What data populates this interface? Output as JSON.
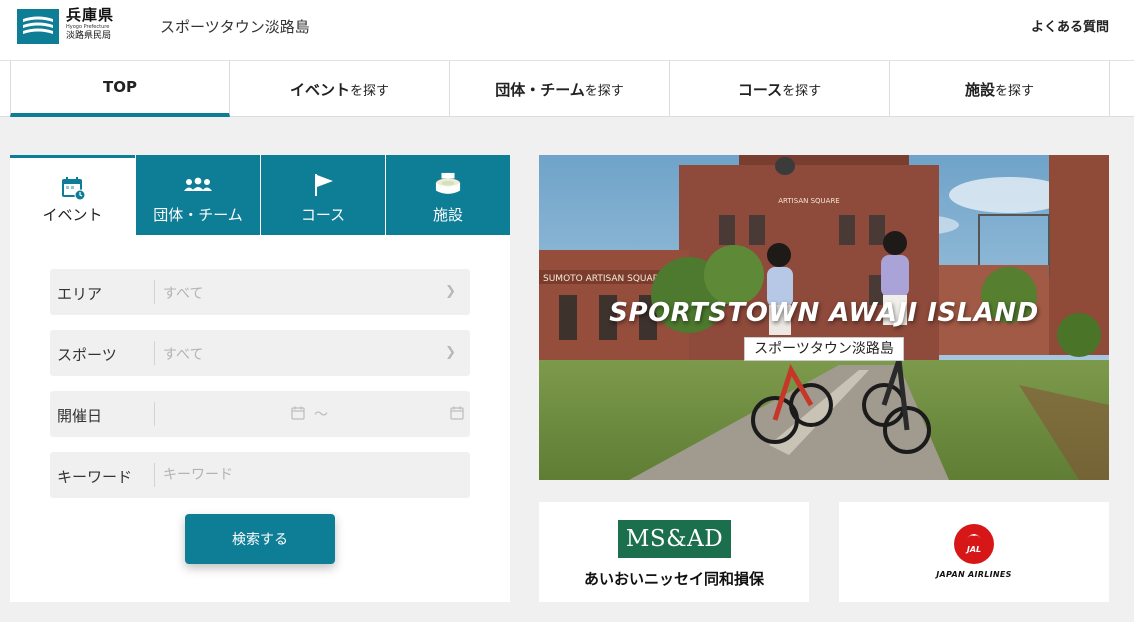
{
  "header": {
    "prefecture": "兵庫県",
    "prefecture_en": "Hyogo Prefecture",
    "office": "淡路県民局",
    "site_name": "スポーツタウン淡路島",
    "faq_link": "よくある質問"
  },
  "nav": [
    {
      "main": "TOP",
      "suffix": ""
    },
    {
      "main": "イベント",
      "suffix": "を探す"
    },
    {
      "main": "団体・チーム",
      "suffix": "を探す"
    },
    {
      "main": "コース",
      "suffix": "を探す"
    },
    {
      "main": "施設",
      "suffix": "を探す"
    }
  ],
  "search": {
    "tabs": [
      {
        "label": "イベント",
        "icon": "calendar-icon"
      },
      {
        "label": "団体・チーム",
        "icon": "group-icon"
      },
      {
        "label": "コース",
        "icon": "flag-icon"
      },
      {
        "label": "施設",
        "icon": "stadium-icon"
      }
    ],
    "area": {
      "label": "エリア",
      "value": "すべて"
    },
    "sports": {
      "label": "スポーツ",
      "value": "すべて"
    },
    "date": {
      "label": "開催日",
      "separator": "～"
    },
    "keyword": {
      "label": "キーワード",
      "placeholder": "キーワード"
    },
    "submit_label": "検索する"
  },
  "hero": {
    "title": "SPORTSTOWN AWAJI ISLAND",
    "subtitle": "スポーツタウン淡路島",
    "building_sign": "SUMOTO ARTISAN SQUARE",
    "roof_sign": "ARTISAN SQUARE"
  },
  "sponsors": [
    {
      "logo_text": "MS&AD",
      "name": "あいおいニッセイ同和損保",
      "color": "#1b6f4c"
    },
    {
      "logo_text": "JAL",
      "name": "JAPAN AIRLINES",
      "color": "#d71618"
    }
  ],
  "colors": {
    "accent": "#0e7d96",
    "background": "#f0f0f0"
  }
}
